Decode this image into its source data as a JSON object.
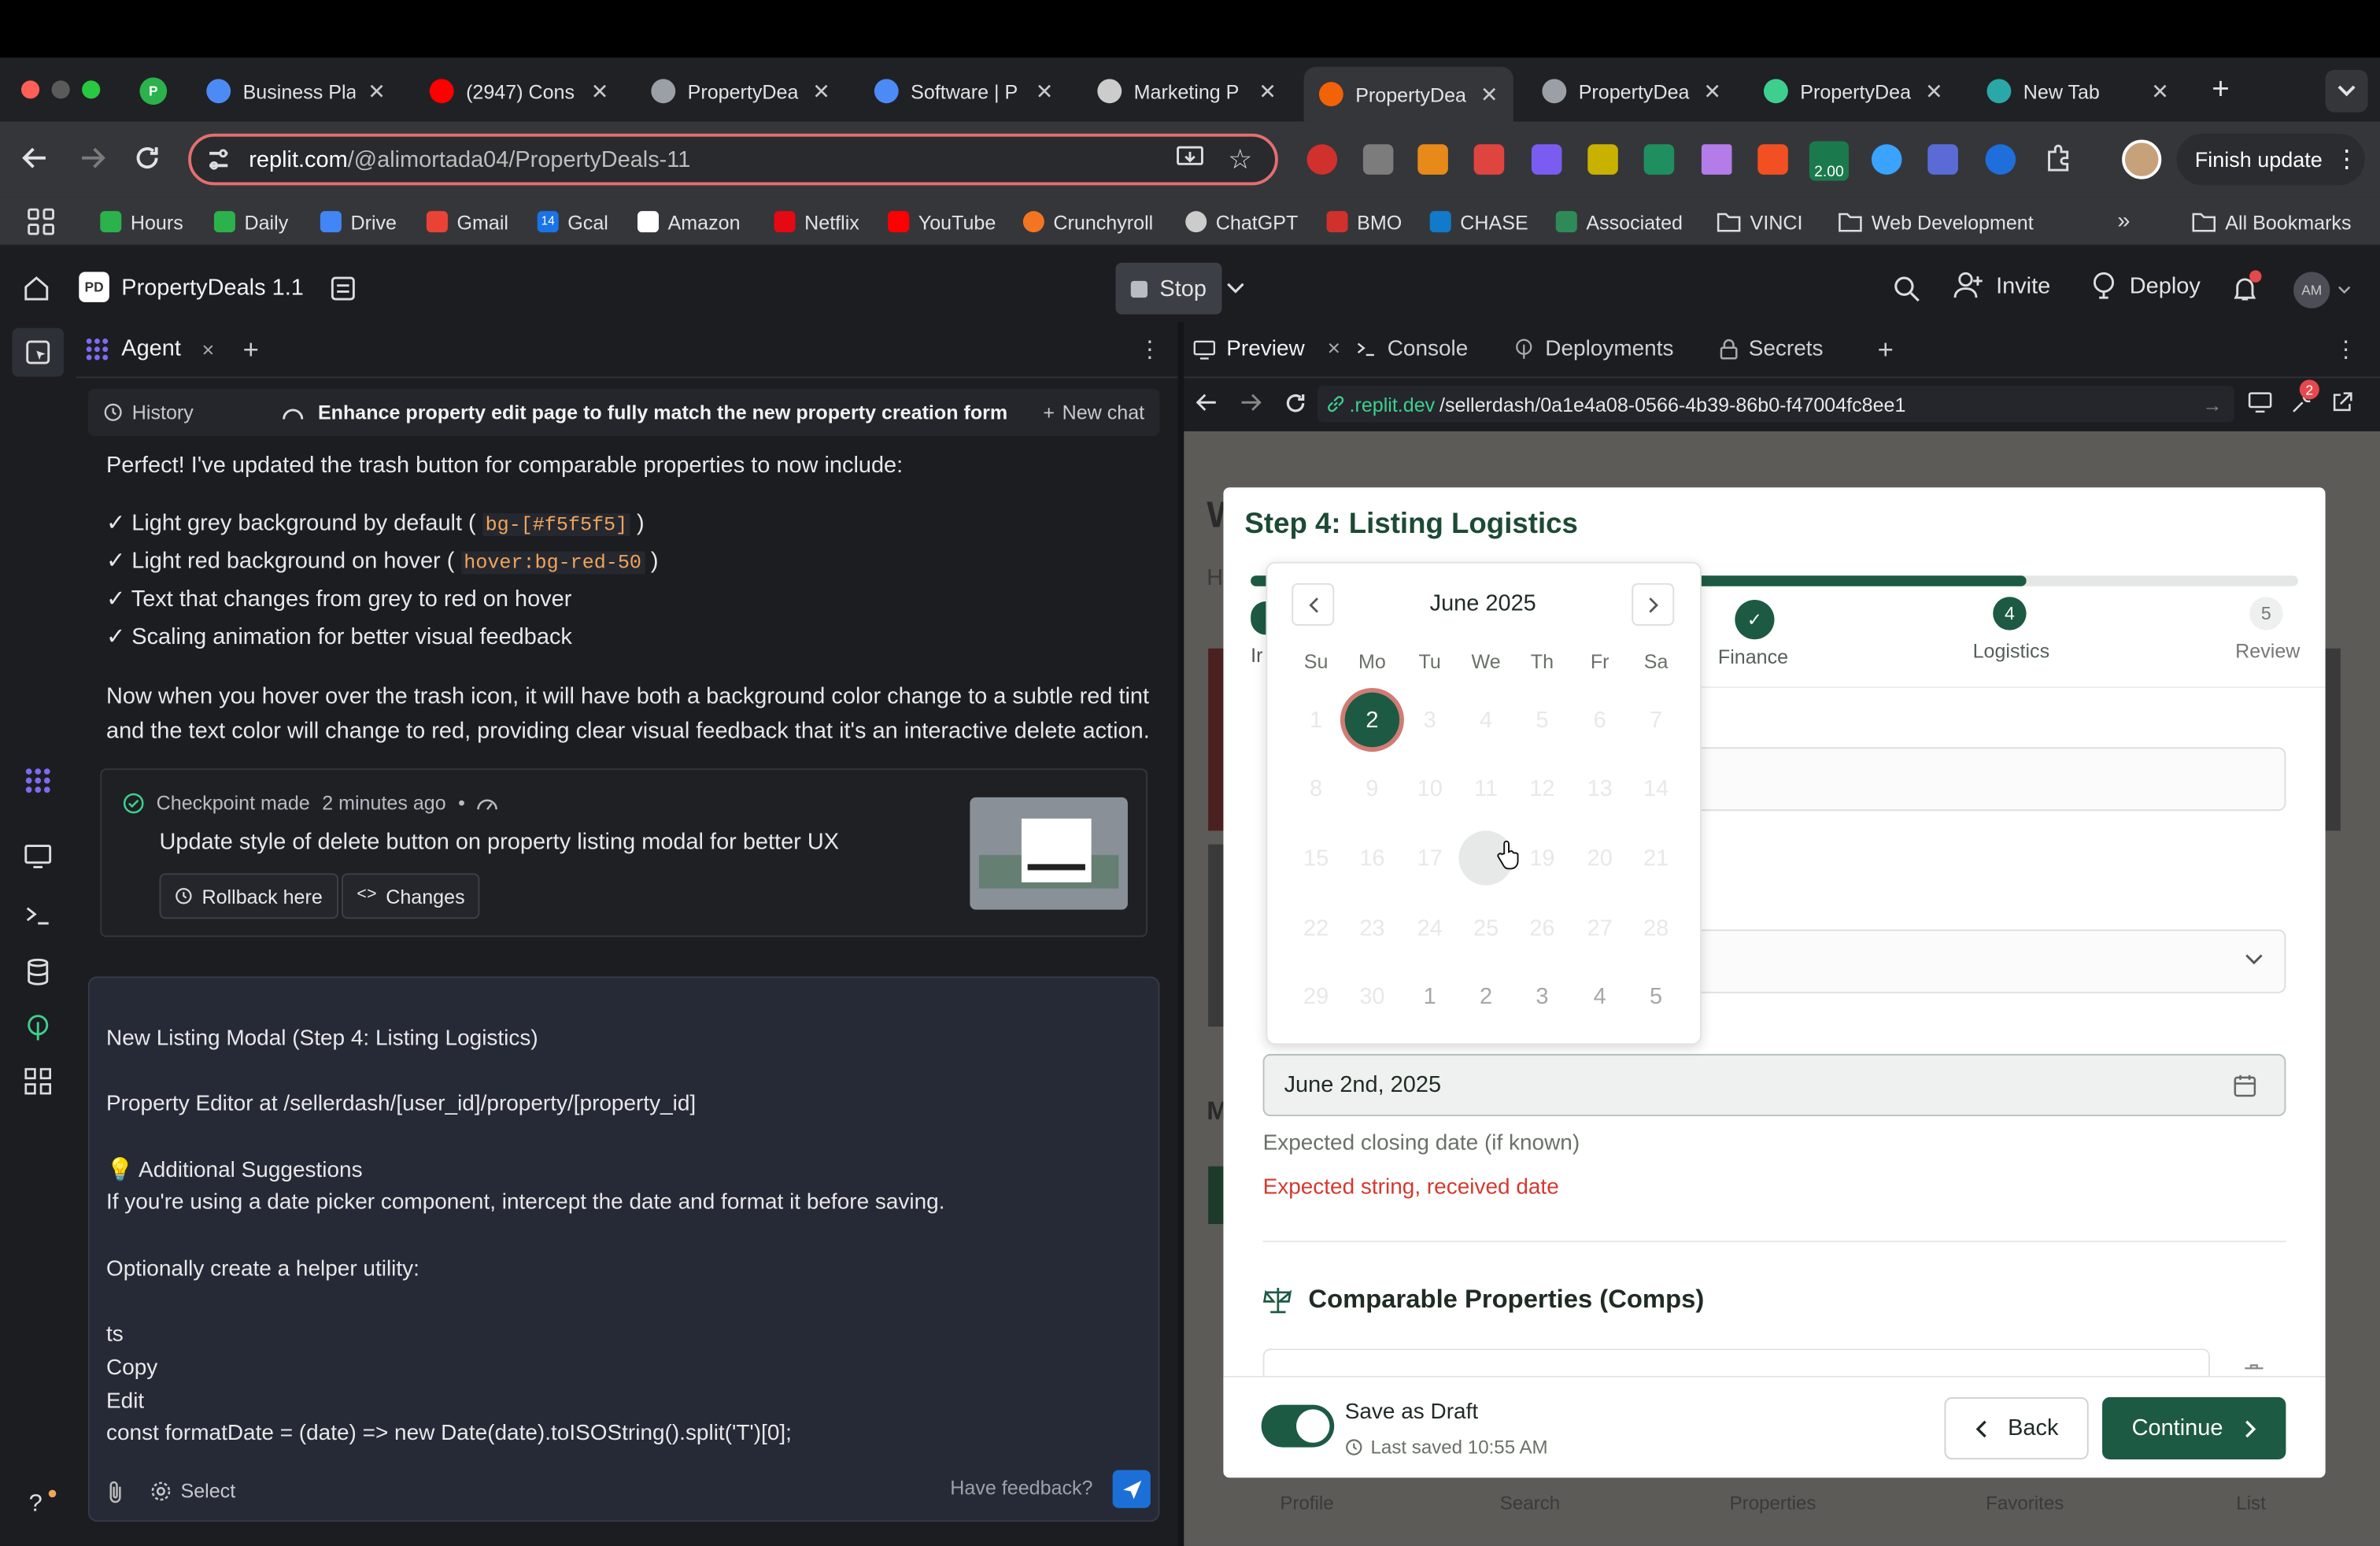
{
  "browser": {
    "tabs": [
      {
        "label": "Business Pla",
        "icon": "docs-icon",
        "color": "#4c8bf5"
      },
      {
        "label": "(2947) Cons",
        "icon": "youtube-icon",
        "color": "#ff0000"
      },
      {
        "label": "PropertyDea",
        "icon": "globe-icon",
        "color": "#9aa0a6"
      },
      {
        "label": "Software | P",
        "icon": "docs-icon",
        "color": "#4c8bf5"
      },
      {
        "label": "Marketing P",
        "icon": "chatgpt-icon",
        "color": "#cccccc"
      },
      {
        "label": "PropertyDea",
        "icon": "replit-icon",
        "color": "#f26207"
      },
      {
        "label": "PropertyDea",
        "icon": "globe-icon",
        "color": "#9aa0a6"
      },
      {
        "label": "PropertyDea",
        "icon": "bolt-icon",
        "color": "#3ecf8e"
      },
      {
        "label": "New Tab",
        "icon": "m-icon",
        "color": "#2aa8a8"
      }
    ],
    "url_host": "replit.com",
    "url_path": "/@alimortada04/PropertyDeals-11",
    "finish_update": "Finish update",
    "ext_badge": "2.00",
    "bookmarks": [
      "Hours",
      "Daily",
      "Drive",
      "Gmail",
      "Gcal",
      "Amazon",
      "Netflix",
      "YouTube",
      "Crunchyroll",
      "ChatGPT",
      "BMO",
      "CHASE",
      "Associated",
      "VINCI",
      "Web Development"
    ],
    "gcal_num": "14",
    "all_bookmarks": "All Bookmarks"
  },
  "replit": {
    "project_name": "PropertyDeals 1.1",
    "stop_label": "Stop",
    "invite_label": "Invite",
    "deploy_label": "Deploy",
    "avatar_initials": "AM",
    "agent_tab": "Agent",
    "history_label": "History",
    "chat_title": "Enhance property edit page to fully match the new property creation form",
    "new_chat": "New chat",
    "message": {
      "intro": "Perfect! I've updated the trash button for comparable properties to now include:",
      "bullets": [
        {
          "pre": "✓ Light grey background by default ( ",
          "code": "bg-[#f5f5f5]",
          "post": " )"
        },
        {
          "pre": "✓ Light red background on hover ( ",
          "code": "hover:bg-red-50",
          "post": " )"
        },
        {
          "pre": "✓ Text that changes from grey to red on hover",
          "code": "",
          "post": ""
        },
        {
          "pre": "✓ Scaling animation for better visual feedback",
          "code": "",
          "post": ""
        }
      ],
      "outro": "Now when you hover over the trash icon, it will have both a background color change to a subtle red tint and the text color will change to red, providing clear visual feedback that it's an interactive delete action."
    },
    "checkpoint": {
      "made": "Checkpoint made",
      "time": "2 minutes ago",
      "sep": "•",
      "description": "Update style of delete button on property listing modal for better UX",
      "rollback": "Rollback here",
      "changes": "Changes"
    },
    "input_lines": [
      "New Listing Modal (Step 4: Listing Logistics)",
      "",
      "Property Editor at /sellerdash/[user_id]/property/[property_id]",
      "",
      "💡 Additional Suggestions",
      "If you're using a date picker component, intercept the date and format it before saving.",
      "",
      "Optionally create a helper utility:",
      "",
      "ts",
      "Copy",
      "Edit",
      "const formatDate = (date) => new Date(date).toISOString().split('T')[0];"
    ],
    "select_label": "Select",
    "feedback_label": "Have feedback?",
    "help_label": "?",
    "preview_tabs": [
      "Preview",
      "Console",
      "Deployments",
      "Secrets"
    ],
    "preview_url_host": ".replit.dev",
    "preview_url_path": "/sellerdash/0a1e4a08-0566-4b39-86b0-f47004fc8ee1",
    "notif_badge": "2"
  },
  "modal": {
    "title": "Step 4: Listing Logistics",
    "progress": 0.74,
    "steps": [
      {
        "label": "Finance",
        "num": "✓"
      },
      {
        "label": "Logistics",
        "num": "4"
      },
      {
        "label": "Review",
        "num": "5"
      }
    ],
    "partial_label": "Ir",
    "calendar": {
      "month": "June 2025",
      "weekdays": [
        "Su",
        "Mo",
        "Tu",
        "We",
        "Th",
        "Fr",
        "Sa"
      ],
      "weeks": [
        [
          "1",
          "2",
          "3",
          "4",
          "5",
          "6",
          "7"
        ],
        [
          "8",
          "9",
          "10",
          "11",
          "12",
          "13",
          "14"
        ],
        [
          "15",
          "16",
          "17",
          "18",
          "19",
          "20",
          "21"
        ],
        [
          "22",
          "23",
          "24",
          "25",
          "26",
          "27",
          "28"
        ],
        [
          "29",
          "30",
          "1",
          "2",
          "3",
          "4",
          "5"
        ]
      ],
      "selected": "2",
      "hovered": "18"
    },
    "date_value": "June 2nd, 2025",
    "date_help": "Expected closing date (if known)",
    "date_error": "Expected string, received date",
    "comps_title": "Comparable Properties (Comps)",
    "save_draft": "Save as Draft",
    "last_saved": "Last saved 10:55 AM",
    "back_label": "Back",
    "continue_label": "Continue"
  },
  "behind_nav": [
    "Profile",
    "Search",
    "Properties",
    "Favorites",
    "List"
  ],
  "colors": {
    "brand_green": "#1d5a43",
    "error": "#d33a2f",
    "accent_orange": "#f0a55b"
  }
}
